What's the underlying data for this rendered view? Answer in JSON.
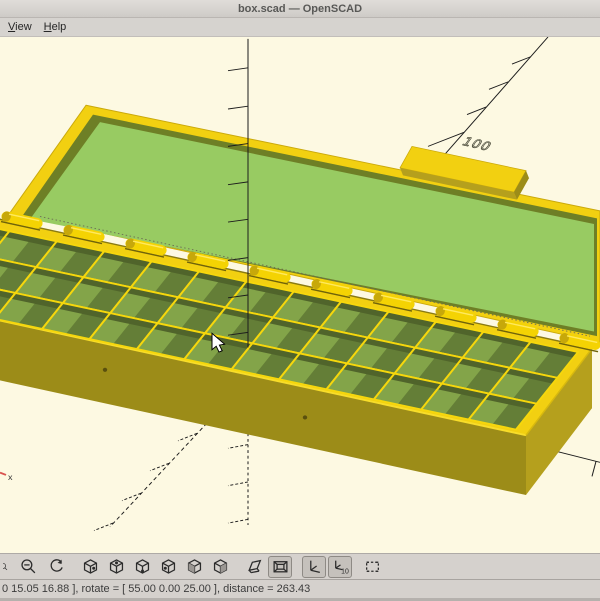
{
  "window": {
    "title": "box.scad — OpenSCAD"
  },
  "menu": {
    "items": [
      {
        "label": "View"
      },
      {
        "label": "Help"
      }
    ]
  },
  "viewport": {
    "y_axis_label": "100",
    "x_axis_marker": "x",
    "colors": {
      "background": "#fdf9e2",
      "gold_top": "#f2d011",
      "gold_line": "#f6d70c",
      "gold_front": "#9c8c18",
      "gold_side": "#b5a01d",
      "gold_edge": "#caa90b",
      "lid_green": "#98cb62",
      "lid_lip": "#6e7f26",
      "cell_dark": "#647e37",
      "cell_light": "#83a449",
      "cell_shadow": "#50642b",
      "hinge": "#f4d303",
      "hinge_end": "#c7a80a",
      "hinge_shadow": "#6f6309",
      "axis": "#1c1c1c",
      "marker_red": "#d9534f"
    }
  },
  "toolbar": {
    "buttons": [
      {
        "name": "zoom-in",
        "active": false,
        "partial": true
      },
      {
        "name": "zoom-out",
        "active": false
      },
      {
        "name": "reset-view",
        "active": false
      },
      {
        "name": "view-right",
        "active": false
      },
      {
        "name": "view-top",
        "active": false
      },
      {
        "name": "view-bottom",
        "active": false
      },
      {
        "name": "view-left",
        "active": false
      },
      {
        "name": "view-front",
        "active": false
      },
      {
        "name": "view-back",
        "active": false
      },
      {
        "name": "view-diagonal",
        "active": false
      },
      {
        "name": "view-orthogonal",
        "active": true
      },
      {
        "name": "show-axes",
        "active": true
      },
      {
        "name": "show-scale-markers",
        "active": true,
        "icon_text": "10"
      },
      {
        "name": "view-all",
        "active": false
      }
    ]
  },
  "statusbar": {
    "text": "0 15.05 16.88 ], rotate = [ 55.00 0.00 25.00 ], distance = 263.43"
  }
}
